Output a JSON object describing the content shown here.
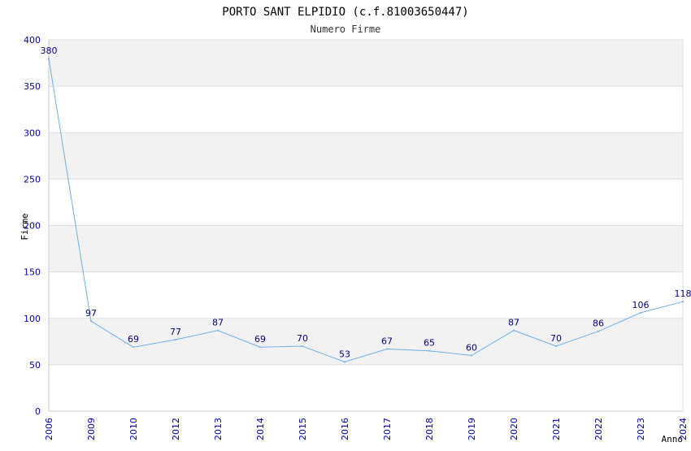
{
  "chart_data": {
    "type": "line",
    "title": "PORTO SANT ELPIDIO (c.f.81003650447)",
    "subtitle": "Numero Firme",
    "xlabel": "Anno",
    "ylabel": "Firme",
    "ylim": [
      0,
      400
    ],
    "yticks": [
      "0",
      "50",
      "100",
      "150",
      "200",
      "250",
      "300",
      "350",
      "400"
    ],
    "categories": [
      "2006",
      "2009",
      "2010",
      "2012",
      "2013",
      "2014",
      "2015",
      "2016",
      "2017",
      "2018",
      "2019",
      "2020",
      "2021",
      "2022",
      "2023",
      "2024"
    ],
    "series": [
      {
        "values": [
          380,
          97,
          69,
          77,
          87,
          69,
          70,
          53,
          67,
          65,
          60,
          87,
          70,
          86,
          106,
          118
        ]
      }
    ],
    "grid": true,
    "legend": "none",
    "colors": {
      "line": "#6aaee8",
      "band": "#f2f2f2",
      "gridline": "#dddddd",
      "tick_text": "#0000aa",
      "data_label": "#000080"
    }
  }
}
